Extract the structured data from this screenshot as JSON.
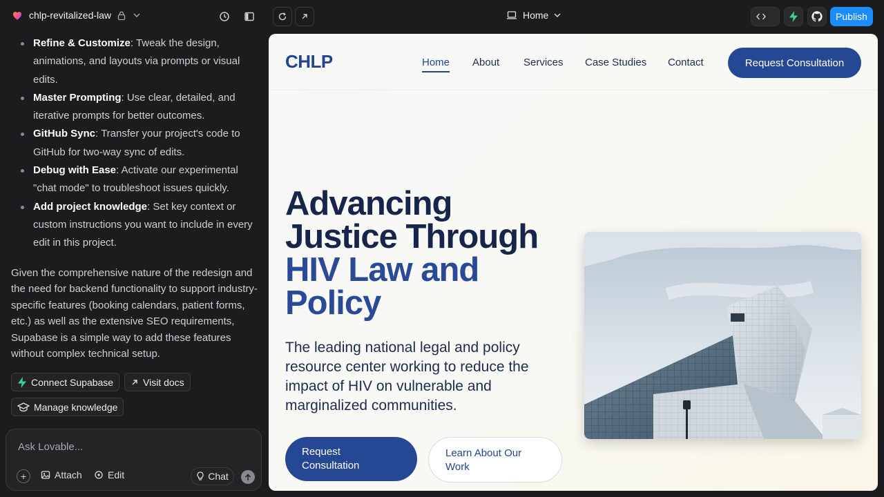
{
  "topbar": {
    "project_name": "chlp-revitalized-law",
    "page_selector": "Home",
    "publish_label": "Publish"
  },
  "chat": {
    "bullets": [
      {
        "title": "Refine & Customize",
        "text": ": Tweak the design, animations, and layouts via prompts or visual edits."
      },
      {
        "title": "Master Prompting",
        "text": ": Use clear, detailed, and iterative prompts for better outcomes."
      },
      {
        "title": "GitHub Sync",
        "text": ": Transfer your project's code to GitHub for two-way sync of edits."
      },
      {
        "title": "Debug with Ease",
        "text": ": Activate our experimental \"chat mode\" to troubleshoot issues quickly."
      },
      {
        "title": "Add project knowledge",
        "text": ": Set key context or custom instructions you want to include in every edit in this project."
      }
    ],
    "paragraph": "Given the comprehensive nature of the redesign and the need for backend functionality to support industry-specific features (booking calendars, patient forms, etc.) as well as the extensive SEO requirements, Supabase is a simple way to add these features without complex technical setup.",
    "actions": {
      "connect_supabase": "Connect Supabase",
      "visit_docs": "Visit docs",
      "manage_knowledge": "Manage knowledge"
    },
    "input": {
      "placeholder": "Ask Lovable...",
      "attach_label": "Attach",
      "edit_label": "Edit",
      "chat_label": "Chat"
    }
  },
  "site": {
    "logo": "CHLP",
    "nav": [
      "Home",
      "About",
      "Services",
      "Case Studies",
      "Contact"
    ],
    "nav_cta": "Request Consultation",
    "hero": {
      "title_line1": "Advancing",
      "title_line2": "Justice Through",
      "title_line3": "HIV Law and",
      "title_line4": "Policy",
      "subtitle": "The leading national legal and policy resource center working to reduce the impact of HIV on vulnerable and marginalized communities.",
      "primary_button": "Request Consultation",
      "secondary_button": "Learn About Our Work"
    }
  },
  "colors": {
    "brand_blue": "#264894",
    "navy": "#18244a",
    "publish_blue": "#1a8cff",
    "supabase_green": "#3ecf8e"
  }
}
